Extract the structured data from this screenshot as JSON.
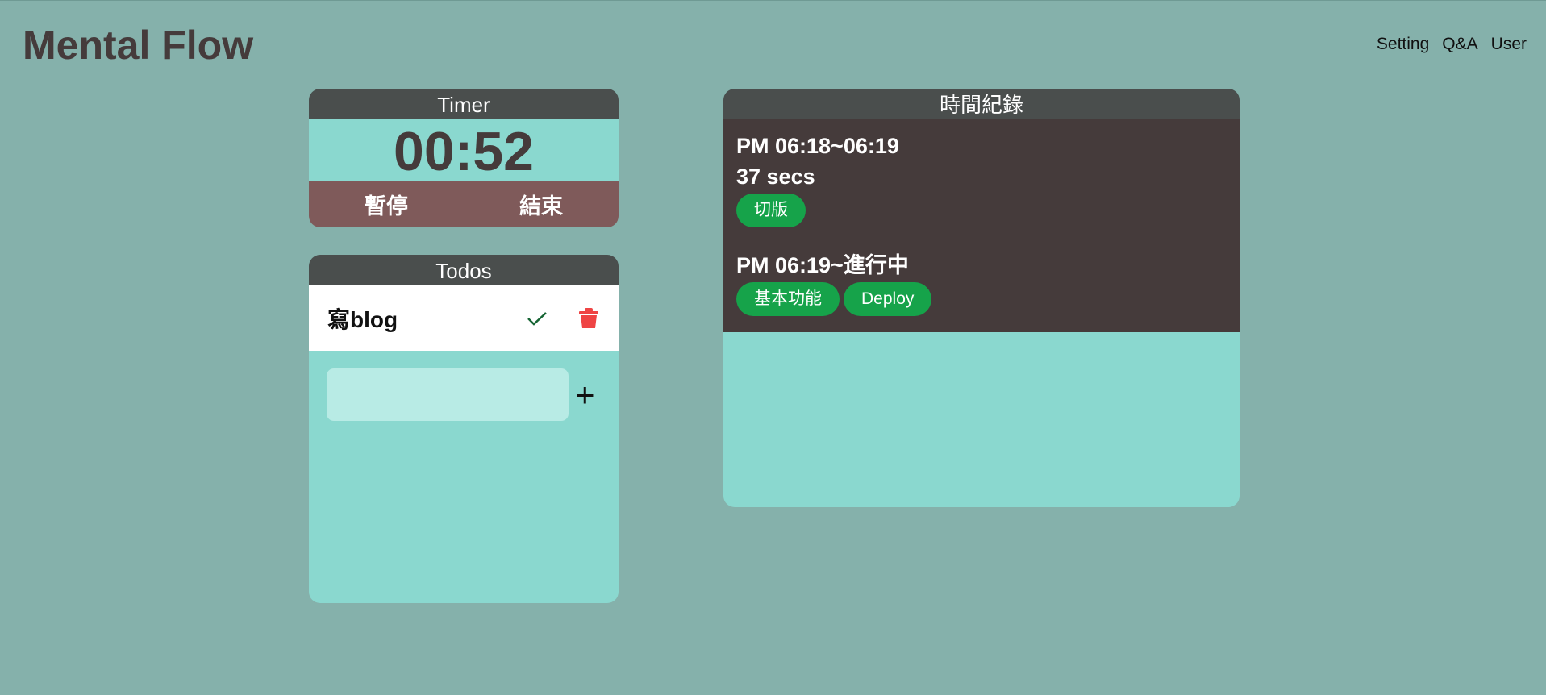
{
  "app": {
    "title": "Mental Flow"
  },
  "nav": [
    "Setting",
    "Q&A",
    "User"
  ],
  "timer": {
    "title": "Timer",
    "time": "00:52",
    "pause_label": "暫停",
    "end_label": "結束"
  },
  "todos": {
    "title": "Todos",
    "items": [
      {
        "text": "寫blog"
      }
    ],
    "input_value": "",
    "add_label": "+"
  },
  "log": {
    "title": "時間紀錄",
    "entries": [
      {
        "range": "PM 06:18~06:19",
        "duration": "37 secs",
        "tags": [
          "切版"
        ]
      },
      {
        "range": "PM 06:19~進行中",
        "tags": [
          "基本功能",
          "Deploy"
        ]
      }
    ]
  },
  "colors": {
    "background": "#85b1ab",
    "card": "#8ad8cf",
    "header": "#4a4e4d",
    "timer_buttons": "#7f5a5a",
    "log_body": "#453b3b",
    "tag": "#16a34a",
    "trash": "#ef4444",
    "check": "#166534"
  }
}
